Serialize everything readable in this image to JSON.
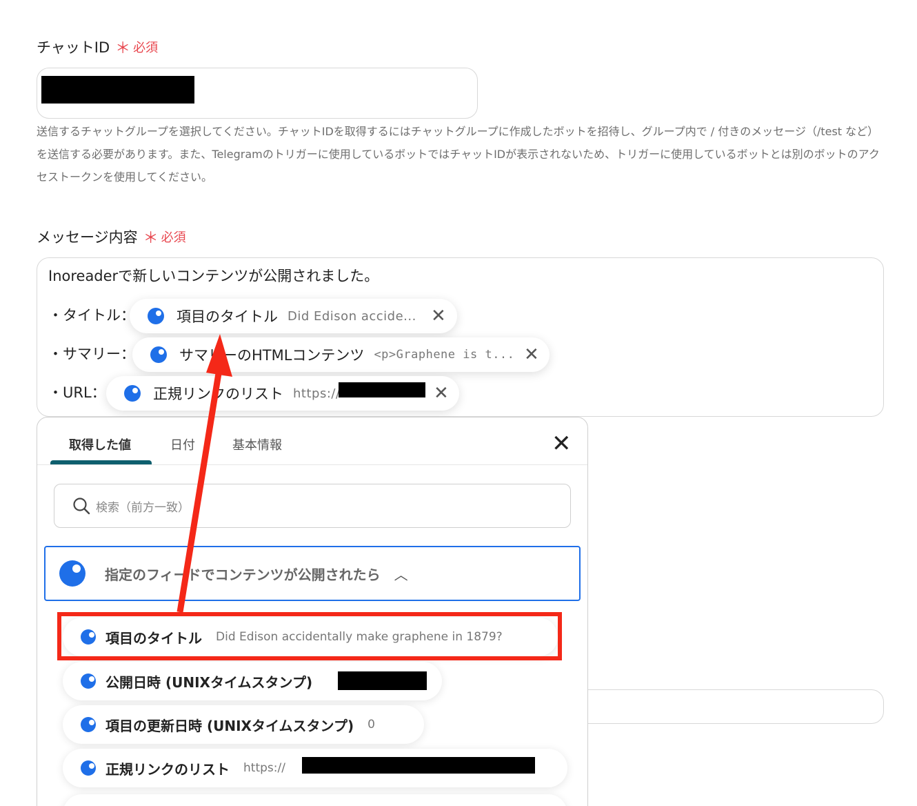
{
  "chat_id": {
    "label": "チャットID",
    "required_mark": "＊",
    "required_text": "必須"
  },
  "chat_help": "送信するチャットグループを選択してください。チャットIDを取得するにはチャットグループに作成したボットを招待し、グループ内で / 付きのメッセージ（/test など）を送信する必要があります。また、Telegramのトリガーに使用しているボットではチャットIDが表示されないため、トリガーに使用しているボットとは別のボットのアクセストークンを使用してください。",
  "message": {
    "label": "メッセージ内容",
    "required_mark": "＊",
    "required_text": "必須",
    "first_line": "Inoreaderで新しいコンテンツが公開されました。",
    "rows": [
      {
        "label": "・タイトル：",
        "chip_name": "項目のタイトル",
        "chip_value": "Did Edison accide..."
      },
      {
        "label": "・サマリー：",
        "chip_name": "サマリーのHTMLコンテンツ",
        "chip_value": "<p>Graphene is t..."
      },
      {
        "label": "・URL：",
        "chip_name": "正規リンクのリスト",
        "chip_value": "https://"
      }
    ]
  },
  "panel": {
    "tabs": [
      "取得した値",
      "日付",
      "基本情報"
    ],
    "search_placeholder": "検索（前方一致）",
    "group_title": "指定のフィードでコンテンツが公開されたら",
    "items": [
      {
        "name": "項目のタイトル",
        "value": "Did Edison accidentally make graphene in 1879?"
      },
      {
        "name": "公開日時 (UNIXタイムスタンプ)",
        "value": ""
      },
      {
        "name": "項目の更新日時 (UNIXタイムスタンプ)",
        "value": "0"
      },
      {
        "name": "正規リンクのリスト",
        "value": "https://"
      }
    ]
  },
  "icons": {
    "close": "close-icon",
    "search": "search-icon",
    "chevron": "chevron-up-icon"
  },
  "colors": {
    "required": "#e8474f",
    "accent": "#1f6fe8",
    "tab_underline": "#0e5f6e",
    "annotation": "#f42818"
  }
}
